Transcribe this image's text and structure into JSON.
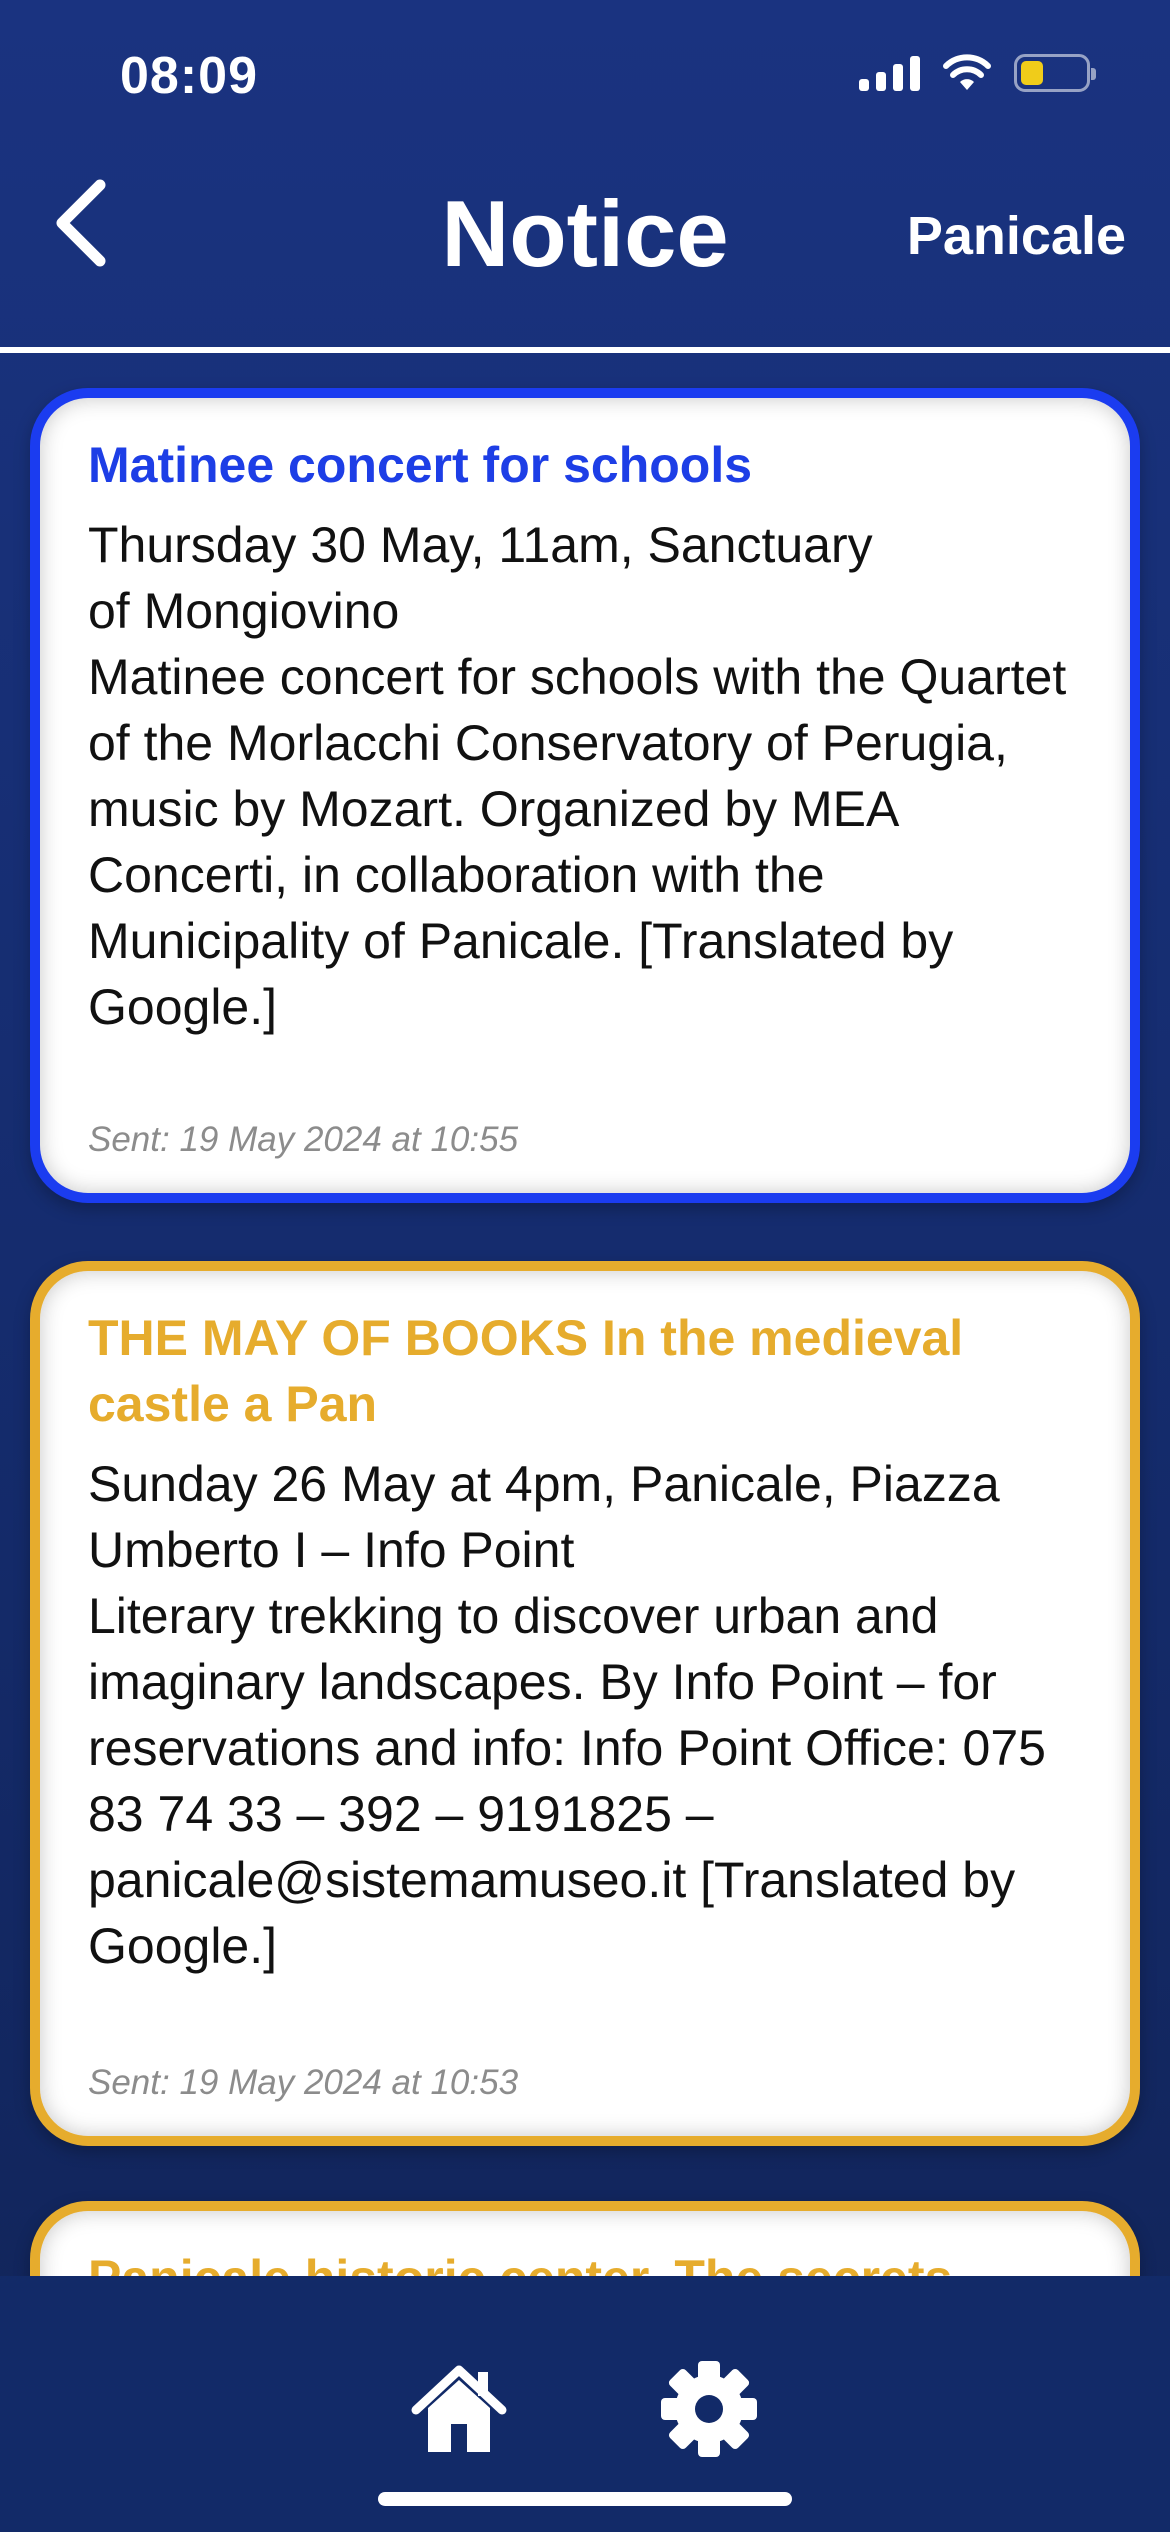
{
  "status_bar": {
    "time": "08:09"
  },
  "header": {
    "title": "Notice",
    "right_label": "Panicale"
  },
  "notices": [
    {
      "title": "Matinee concert for schools",
      "body": "Thursday 30 May, 11am, Sanctuary\nof Mongiovino\nMatinee concert for schools with the Quartet of the Morlacchi Conservatory of Perugia, music by Mozart. Organized by MEA Concerti, in collaboration with the Municipality of Panicale. [Translated by Google.]",
      "sent": "Sent: 19 May 2024 at 10:55",
      "accent": "#1b3cf0"
    },
    {
      "title": "THE MAY OF BOOKS In the medieval castle a Pan",
      "body": "Sunday 26 May at 4pm, Panicale, Piazza Umberto I – Info Point\nLiterary trekking to discover urban and imaginary landscapes. By Info Point – for reservations and info: Info Point Office: 075 83 74 33 – 392 – 9191825 – panicale@sistemamuseo.it [Translated by Google.]",
      "sent": "Sent: 19 May 2024 at 10:53",
      "accent": "#e6ac2d"
    },
    {
      "title": "Panicale historic center. The secrets",
      "accent": "#e6ac2d"
    }
  ],
  "tabbar": {
    "items": [
      {
        "icon": "home-icon"
      },
      {
        "icon": "gear-icon"
      }
    ]
  },
  "colors": {
    "background": "#152c6e",
    "tabbar": "#122a68",
    "read_accent": "#1b3cf0",
    "unread_accent": "#e6ac2d"
  }
}
